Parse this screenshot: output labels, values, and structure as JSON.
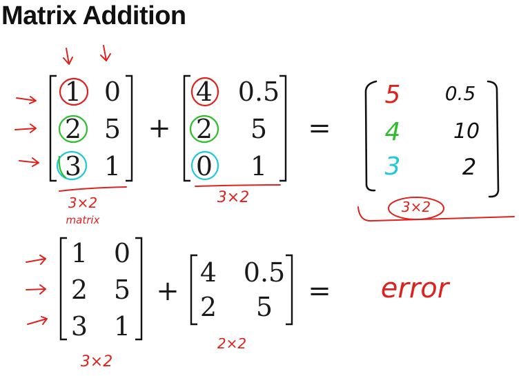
{
  "title": "Matrix Addition",
  "example1": {
    "A": [
      [
        "1",
        "0"
      ],
      [
        "2",
        "5"
      ],
      [
        "3",
        "1"
      ]
    ],
    "B": [
      [
        "4",
        "0.5"
      ],
      [
        "2",
        "5"
      ],
      [
        "0",
        "1"
      ]
    ],
    "plus": "+",
    "equals": "=",
    "result": [
      [
        "5",
        "0.5"
      ],
      [
        "4",
        "10"
      ],
      [
        "3",
        "2"
      ]
    ],
    "A_dim": "3×2",
    "A_note": "matrix",
    "B_dim": "3×2",
    "result_dim": "3×2"
  },
  "example2": {
    "A": [
      [
        "1",
        "0"
      ],
      [
        "2",
        "5"
      ],
      [
        "3",
        "1"
      ]
    ],
    "B": [
      [
        "4",
        "0.5"
      ],
      [
        "2",
        "5"
      ]
    ],
    "plus": "+",
    "equals": "=",
    "result": "error",
    "A_dim": "3×2",
    "B_dim": "2×2"
  },
  "annotation_colors": {
    "red": "#e0201c",
    "green": "#2cbe2c",
    "cyan": "#1ec8d8",
    "ink": "#111111"
  }
}
